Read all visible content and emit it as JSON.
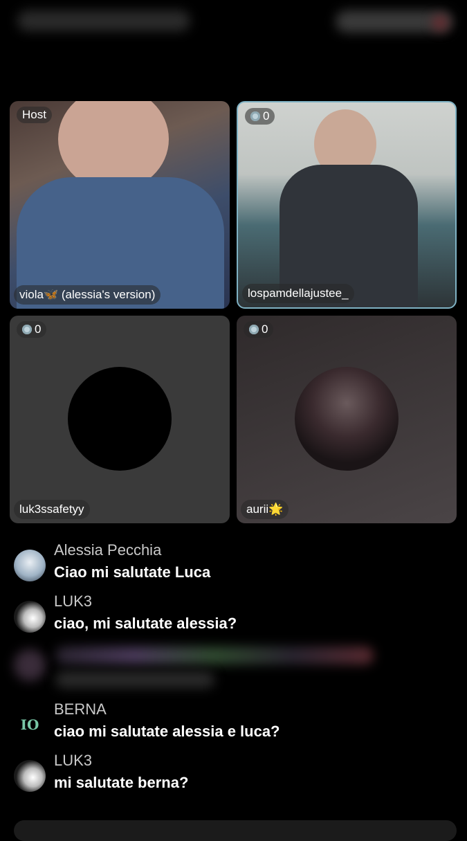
{
  "tiles": [
    {
      "badge": "Host",
      "name": "viola🦋 (alessia's version)"
    },
    {
      "badge_count": "0",
      "name": "lospamdellajustee_"
    },
    {
      "badge_count": "0",
      "name": "luk3ssafetyy"
    },
    {
      "badge_count": "0",
      "name": "aurii🌟"
    }
  ],
  "chat": [
    {
      "user": "Alessia Pecchia",
      "text": "Ciao mi salutate Luca"
    },
    {
      "user": "LUK3",
      "text": "ciao, mi salutate alessia?"
    },
    {
      "user": "BERNA",
      "text": "ciao mi salutate alessia e luca?"
    },
    {
      "user": "LUK3",
      "text": "mi salutate berna?"
    }
  ],
  "berna_avatar_text": "IO"
}
